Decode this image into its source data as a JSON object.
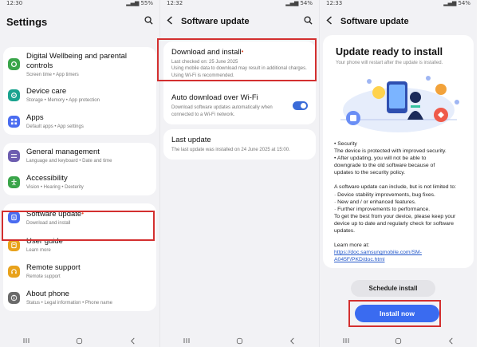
{
  "screen1": {
    "status": {
      "time": "12:30",
      "battery": "55%"
    },
    "title": "Settings",
    "groups": [
      [
        {
          "title": "Digital Wellbeing and parental controls",
          "sub": "Screen time  •  App timers",
          "icon": "wellbeing-icon",
          "color": "#3aa54a"
        },
        {
          "title": "Device care",
          "sub": "Storage  •  Memory  •  App protection",
          "icon": "device-care-icon",
          "color": "#1aa38f"
        },
        {
          "title": "Apps",
          "sub": "Default apps  •  App settings",
          "icon": "apps-icon",
          "color": "#4a6cf0"
        }
      ],
      [
        {
          "title": "General management",
          "sub": "Language and keyboard  •  Date and time",
          "icon": "general-management-icon",
          "color": "#6d5db0"
        },
        {
          "title": "Accessibility",
          "sub": "Vision  •  Hearing  •  Dexterity",
          "icon": "accessibility-icon",
          "color": "#3aa54a"
        }
      ],
      [
        {
          "title": "Software update",
          "sub": "Download and install",
          "icon": "software-update-icon",
          "color": "#4a6cf0",
          "dot": "•"
        },
        {
          "title": "User guide",
          "sub": "Learn more",
          "icon": "user-guide-icon",
          "color": "#e8a21c"
        },
        {
          "title": "Remote support",
          "sub": "Remote support",
          "icon": "remote-support-icon",
          "color": "#e8a21c"
        },
        {
          "title": "About phone",
          "sub": "Status  •  Legal information  •  Phone name",
          "icon": "about-phone-icon",
          "color": "#6a6a6a"
        }
      ]
    ]
  },
  "screen2": {
    "status": {
      "time": "12:32",
      "battery": "54%"
    },
    "title": "Software update",
    "download": {
      "title": "Download and install",
      "dot": "•",
      "sub": "Last checked on: 25 June 2025\nUsing mobile data to download may result in additional charges. Using Wi-Fi is recommended."
    },
    "auto": {
      "title": "Auto download over Wi-Fi",
      "sub": "Download software updates automatically when connected to a Wi-Fi network."
    },
    "last": {
      "title": "Last update",
      "sub": "The last update was installed on 24 June 2025 at 15:00."
    }
  },
  "screen3": {
    "status": {
      "time": "12:33",
      "battery": "54%"
    },
    "header": "Software update",
    "title": "Update ready to install",
    "subtitle": "Your phone will restart after the update is installed.",
    "notes": [
      "• Security",
      "The device is protected with improved security.",
      "• After updating, you will not be able to",
      "downgrade to the old software because of",
      "updates to the security policy.",
      "",
      "A software update can include, but is not limited to:",
      "· Device stability improvements, bug fixes.",
      "· New and / or enhanced features.",
      "· Further improvements to performance.",
      "To get the best from your device, please keep your device up to date and regularly check for software updates.",
      "",
      "Learn more at:"
    ],
    "link": "https://doc.samsungmobile.com/SM-A045F/PKD/doc.html",
    "schedule_button": "Schedule install",
    "install_button": "Install now"
  },
  "colors": {
    "accent": "#3a6bf0",
    "highlight": "#d32f2f",
    "toggle": "#3a6bd8"
  }
}
